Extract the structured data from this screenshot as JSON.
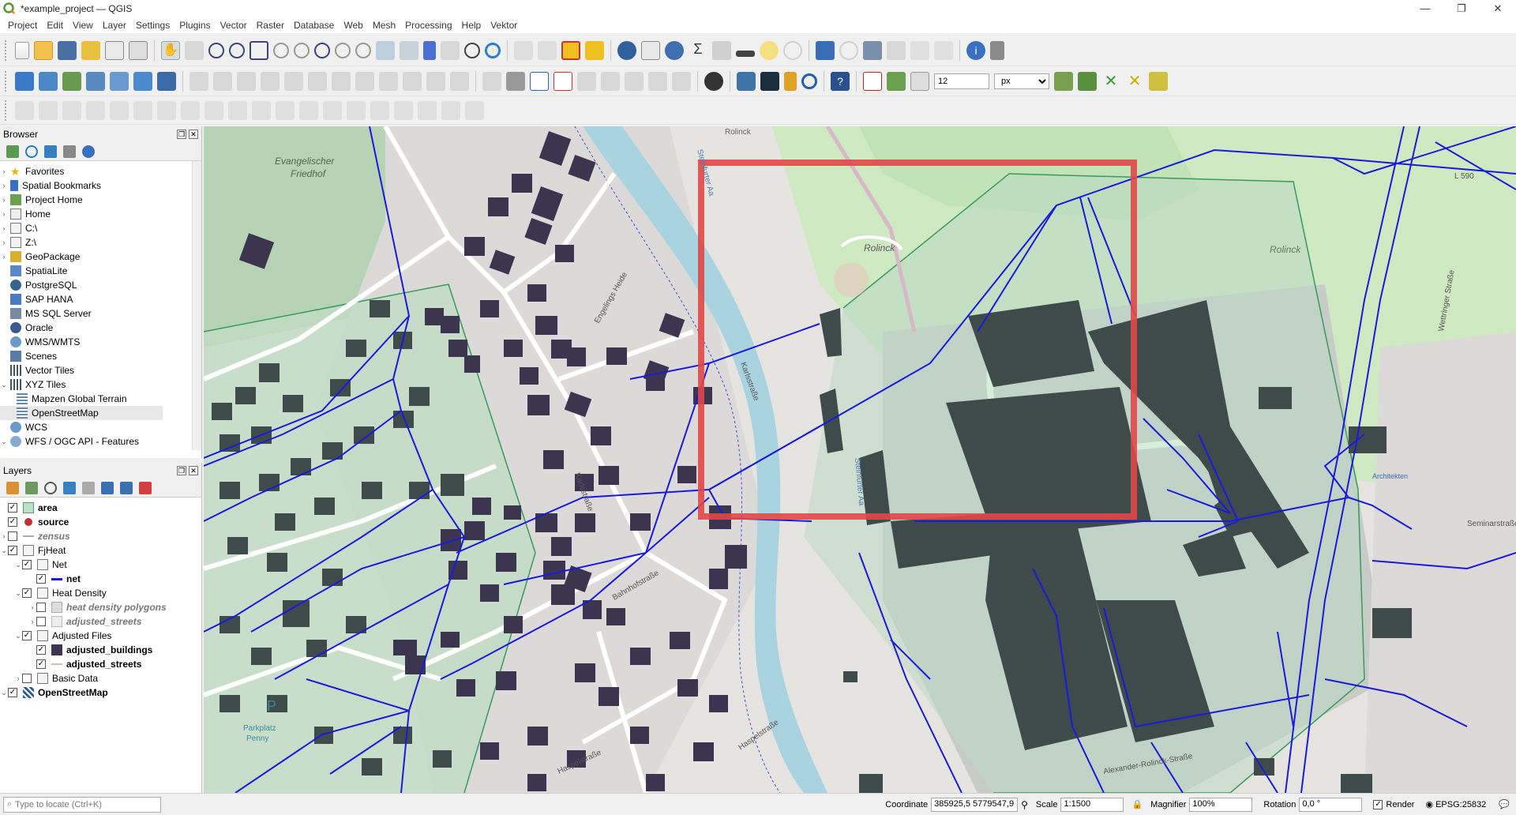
{
  "window": {
    "title": "*example_project — QGIS",
    "controls": [
      "—",
      "❐",
      "✕"
    ]
  },
  "menu": [
    "Project",
    "Edit",
    "View",
    "Layer",
    "Settings",
    "Plugins",
    "Vector",
    "Raster",
    "Database",
    "Web",
    "Mesh",
    "Processing",
    "Help",
    "Vektor"
  ],
  "toolbar": {
    "snap_tolerance": "12",
    "snap_unit": "px"
  },
  "browser": {
    "title": "Browser",
    "items": [
      {
        "label": "Favorites",
        "icon": "star-icon"
      },
      {
        "label": "Spatial Bookmarks",
        "icon": "bookmark-icon"
      },
      {
        "label": "Project Home",
        "icon": "folder-icon"
      },
      {
        "label": "Home",
        "icon": "folder-icon"
      },
      {
        "label": "C:\\",
        "icon": "folder-icon"
      },
      {
        "label": "Z:\\",
        "icon": "folder-icon"
      },
      {
        "label": "GeoPackage",
        "icon": "geopackage-icon"
      },
      {
        "label": "SpatiaLite",
        "icon": "spatialite-icon"
      },
      {
        "label": "PostgreSQL",
        "icon": "postgresql-icon"
      },
      {
        "label": "SAP HANA",
        "icon": "database-icon"
      },
      {
        "label": "MS SQL Server",
        "icon": "database-icon"
      },
      {
        "label": "Oracle",
        "icon": "database-icon"
      },
      {
        "label": "WMS/WMTS",
        "icon": "globe-icon"
      },
      {
        "label": "Scenes",
        "icon": "scenes-icon"
      },
      {
        "label": "Vector Tiles",
        "icon": "grid-icon"
      },
      {
        "label": "XYZ Tiles",
        "icon": "grid-icon"
      },
      {
        "label": "Mapzen Global Terrain",
        "icon": "grid-icon"
      },
      {
        "label": "OpenStreetMap",
        "icon": "grid-icon"
      },
      {
        "label": "WCS",
        "icon": "globe-icon"
      },
      {
        "label": "WFS / OGC API - Features",
        "icon": "globe-icon"
      }
    ]
  },
  "layers": {
    "title": "Layers",
    "items": [
      {
        "label": "area",
        "checked": true
      },
      {
        "label": "source",
        "checked": true
      },
      {
        "label": "zensus",
        "checked": false
      },
      {
        "label": "FjHeat",
        "checked": true
      },
      {
        "label": "Net",
        "checked": true
      },
      {
        "label": "net",
        "checked": true
      },
      {
        "label": "Heat Density",
        "checked": true
      },
      {
        "label": "heat density polygons",
        "checked": false
      },
      {
        "label": "adjusted_streets",
        "checked": false
      },
      {
        "label": "Adjusted Files",
        "checked": true
      },
      {
        "label": "adjusted_buildings",
        "checked": true
      },
      {
        "label": "adjusted_streets",
        "checked": true
      },
      {
        "label": "Basic Data",
        "checked": false
      },
      {
        "label": "OpenStreetMap",
        "checked": true
      }
    ]
  },
  "map": {
    "labels": {
      "friedhof_1": "Evangelischer",
      "friedhof_2": "Friedhof",
      "rolinck_1": "Rolinck",
      "rolinck_2": "Rolinck",
      "rolinck_3": "Rolinck",
      "steinfurter_aa_1": "Steinfurter Aa",
      "steinfurter_aa_2": "Steinfurter Aa",
      "engelings_heide": "Engelings Heide",
      "karlsstrasse_1": "Karlsstraße",
      "karlsstrasse_2": "Karlsstraße",
      "bahnhofstrasse": "Bahnhofstraße",
      "haspelstrasse_1": "Haspelstraße",
      "haspelstrasse_2": "Haspelstraße",
      "seminarstrasse": "Seminarstraße",
      "wettringer_strasse": "Wettringer Straße",
      "parkplatz_1": "Parkplatz",
      "parkplatz_2": "Penny",
      "alexander": "Alexander-Rolinck-Straße",
      "l590": "L 590",
      "architekten": "Architekten"
    },
    "colors": {
      "net": "#1a1adc",
      "buildings": "#3f4a4a",
      "selection": "#e04848",
      "area": "#3a9a5a"
    }
  },
  "status": {
    "locate_placeholder": "Type to locate (Ctrl+K)",
    "coordinate_label": "Coordinate",
    "coordinate": "385925,5  5779547,9",
    "scale_label": "Scale",
    "scale": "1:1500",
    "magnifier_label": "Magnifier",
    "magnifier": "100%",
    "rotation_label": "Rotation",
    "rotation": "0,0 °",
    "render_label": "Render",
    "crs": "EPSG:25832"
  }
}
